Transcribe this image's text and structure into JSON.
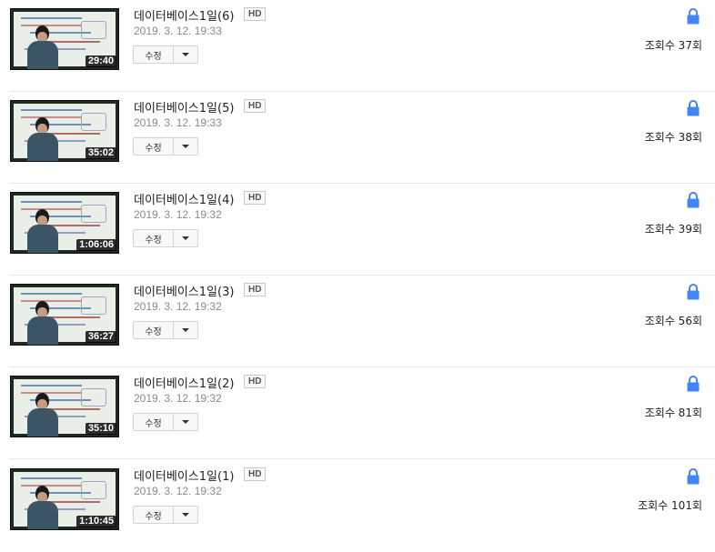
{
  "videos": [
    {
      "title": "데이터베이스1일(6)",
      "badge": "HD",
      "date": "2019. 3. 12. 19:33",
      "duration": "29:40",
      "edit_label": "수정",
      "views": "조회수 37회",
      "privacy_icon": "lock-icon"
    },
    {
      "title": "데이터베이스1일(5)",
      "badge": "HD",
      "date": "2019. 3. 12. 19:33",
      "duration": "35:02",
      "edit_label": "수정",
      "views": "조회수 38회",
      "privacy_icon": "lock-icon"
    },
    {
      "title": "데이터베이스1일(4)",
      "badge": "HD",
      "date": "2019. 3. 12. 19:32",
      "duration": "1:06:06",
      "edit_label": "수정",
      "views": "조회수 39회",
      "privacy_icon": "lock-icon"
    },
    {
      "title": "데이터베이스1일(3)",
      "badge": "HD",
      "date": "2019. 3. 12. 19:32",
      "duration": "36:27",
      "edit_label": "수정",
      "views": "조회수 56회",
      "privacy_icon": "lock-icon"
    },
    {
      "title": "데이터베이스1일(2)",
      "badge": "HD",
      "date": "2019. 3. 12. 19:32",
      "duration": "35:10",
      "edit_label": "수정",
      "views": "조회수 81회",
      "privacy_icon": "lock-icon"
    },
    {
      "title": "데이터베이스1일(1)",
      "badge": "HD",
      "date": "2019. 3. 12. 19:32",
      "duration": "1:10:45",
      "edit_label": "수정",
      "views": "조회수 101회",
      "privacy_icon": "lock-icon"
    }
  ],
  "colors": {
    "lock": "#4285f4",
    "divider": "#e8e8e8",
    "date_text": "#8a8a8a"
  }
}
